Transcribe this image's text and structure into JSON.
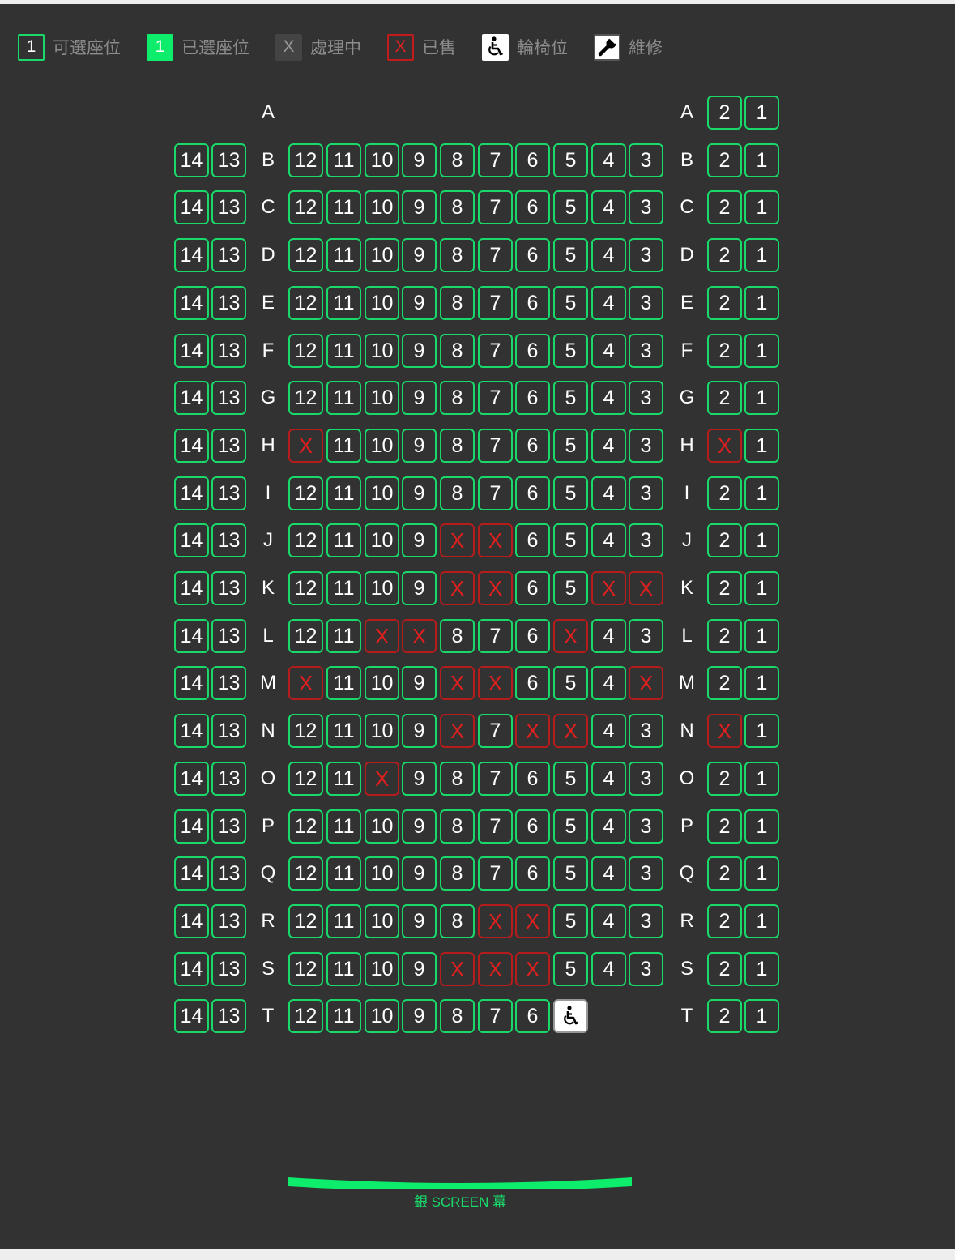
{
  "legend": [
    {
      "key": "available",
      "icon": "1",
      "label": "可選座位"
    },
    {
      "key": "selected",
      "icon": "1",
      "label": "已選座位"
    },
    {
      "key": "processing",
      "icon": "X",
      "label": "處理中"
    },
    {
      "key": "sold",
      "icon": "X",
      "label": "已售"
    },
    {
      "key": "wheelchair",
      "icon": "wheelchair-icon",
      "label": "輪椅位"
    },
    {
      "key": "maintenance",
      "icon": "wrench-icon",
      "label": "維修"
    }
  ],
  "colors": {
    "available_border": "#19d96a",
    "selected_fill": "#0dec6a",
    "sold_border": "#b51c1c",
    "sold_text": "#e01f1f",
    "background": "#323232"
  },
  "sold_mark": "X",
  "rows": [
    {
      "label": "A",
      "left": [],
      "middle": [],
      "right": [
        "2",
        "1"
      ]
    },
    {
      "label": "B",
      "left": [
        "14",
        "13"
      ],
      "middle": [
        "12",
        "11",
        "10",
        "9",
        "8",
        "7",
        "6",
        "5",
        "4",
        "3"
      ],
      "right": [
        "2",
        "1"
      ]
    },
    {
      "label": "C",
      "left": [
        "14",
        "13"
      ],
      "middle": [
        "12",
        "11",
        "10",
        "9",
        "8",
        "7",
        "6",
        "5",
        "4",
        "3"
      ],
      "right": [
        "2",
        "1"
      ]
    },
    {
      "label": "D",
      "left": [
        "14",
        "13"
      ],
      "middle": [
        "12",
        "11",
        "10",
        "9",
        "8",
        "7",
        "6",
        "5",
        "4",
        "3"
      ],
      "right": [
        "2",
        "1"
      ]
    },
    {
      "label": "E",
      "left": [
        "14",
        "13"
      ],
      "middle": [
        "12",
        "11",
        "10",
        "9",
        "8",
        "7",
        "6",
        "5",
        "4",
        "3"
      ],
      "right": [
        "2",
        "1"
      ]
    },
    {
      "label": "F",
      "left": [
        "14",
        "13"
      ],
      "middle": [
        "12",
        "11",
        "10",
        "9",
        "8",
        "7",
        "6",
        "5",
        "4",
        "3"
      ],
      "right": [
        "2",
        "1"
      ]
    },
    {
      "label": "G",
      "left": [
        "14",
        "13"
      ],
      "middle": [
        "12",
        "11",
        "10",
        "9",
        "8",
        "7",
        "6",
        "5",
        "4",
        "3"
      ],
      "right": [
        "2",
        "1"
      ]
    },
    {
      "label": "H",
      "left": [
        "14",
        "13"
      ],
      "middle": [
        "X",
        "11",
        "10",
        "9",
        "8",
        "7",
        "6",
        "5",
        "4",
        "3"
      ],
      "right": [
        "X",
        "1"
      ]
    },
    {
      "label": "I",
      "left": [
        "14",
        "13"
      ],
      "middle": [
        "12",
        "11",
        "10",
        "9",
        "8",
        "7",
        "6",
        "5",
        "4",
        "3"
      ],
      "right": [
        "2",
        "1"
      ]
    },
    {
      "label": "J",
      "left": [
        "14",
        "13"
      ],
      "middle": [
        "12",
        "11",
        "10",
        "9",
        "X",
        "X",
        "6",
        "5",
        "4",
        "3"
      ],
      "right": [
        "2",
        "1"
      ]
    },
    {
      "label": "K",
      "left": [
        "14",
        "13"
      ],
      "middle": [
        "12",
        "11",
        "10",
        "9",
        "X",
        "X",
        "6",
        "5",
        "X",
        "X"
      ],
      "right": [
        "2",
        "1"
      ]
    },
    {
      "label": "L",
      "left": [
        "14",
        "13"
      ],
      "middle": [
        "12",
        "11",
        "X",
        "X",
        "8",
        "7",
        "6",
        "X",
        "4",
        "3"
      ],
      "right": [
        "2",
        "1"
      ]
    },
    {
      "label": "M",
      "left": [
        "14",
        "13"
      ],
      "middle": [
        "X",
        "11",
        "10",
        "9",
        "X",
        "X",
        "6",
        "5",
        "4",
        "X"
      ],
      "right": [
        "2",
        "1"
      ]
    },
    {
      "label": "N",
      "left": [
        "14",
        "13"
      ],
      "middle": [
        "12",
        "11",
        "10",
        "9",
        "X",
        "7",
        "X",
        "X",
        "4",
        "3"
      ],
      "right": [
        "X",
        "1"
      ]
    },
    {
      "label": "O",
      "left": [
        "14",
        "13"
      ],
      "middle": [
        "12",
        "11",
        "X",
        "9",
        "8",
        "7",
        "6",
        "5",
        "4",
        "3"
      ],
      "right": [
        "2",
        "1"
      ]
    },
    {
      "label": "P",
      "left": [
        "14",
        "13"
      ],
      "middle": [
        "12",
        "11",
        "10",
        "9",
        "8",
        "7",
        "6",
        "5",
        "4",
        "3"
      ],
      "right": [
        "2",
        "1"
      ]
    },
    {
      "label": "Q",
      "left": [
        "14",
        "13"
      ],
      "middle": [
        "12",
        "11",
        "10",
        "9",
        "8",
        "7",
        "6",
        "5",
        "4",
        "3"
      ],
      "right": [
        "2",
        "1"
      ]
    },
    {
      "label": "R",
      "left": [
        "14",
        "13"
      ],
      "middle": [
        "12",
        "11",
        "10",
        "9",
        "8",
        "X",
        "X",
        "5",
        "4",
        "3"
      ],
      "right": [
        "2",
        "1"
      ]
    },
    {
      "label": "S",
      "left": [
        "14",
        "13"
      ],
      "middle": [
        "12",
        "11",
        "10",
        "9",
        "X",
        "X",
        "X",
        "5",
        "4",
        "3"
      ],
      "right": [
        "2",
        "1"
      ]
    },
    {
      "label": "T",
      "left": [
        "14",
        "13"
      ],
      "middle": [
        "12",
        "11",
        "10",
        "9",
        "8",
        "7",
        "6",
        "WHEELCHAIR"
      ],
      "right": [
        "2",
        "1"
      ]
    }
  ],
  "screen": {
    "label": "銀 SCREEN 幕"
  }
}
